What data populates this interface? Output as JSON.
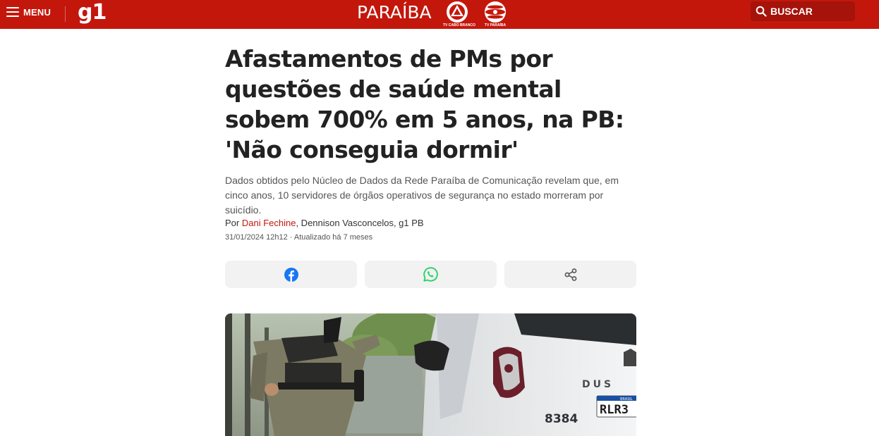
{
  "header": {
    "menu_label": "MENU",
    "logo": "g1",
    "region": "PARAÍBA",
    "affiliates": [
      {
        "label": "TV CABO BRANCO"
      },
      {
        "label": "TV PARAÍBA"
      }
    ],
    "search_label": "BUSCAR",
    "colors": {
      "brand": "#c4170c",
      "search_bg": "#a5130a"
    }
  },
  "article": {
    "title": "Afastamentos de PMs por questões de saúde mental sobem 700% em 5 anos, na PB: 'Não conseguia dormir'",
    "subtitle": "Dados obtidos pelo Núcleo de Dados da Rede Paraíba de Comunicação revelam que, em cinco anos, 10 servidores de órgãos operativos de segurança no estado morreram por suicídio.",
    "byline_prefix": "Por ",
    "author_link": "Dani Fechine",
    "byline_rest": ", Dennison Vasconcelos, g1 PB",
    "dateline": "31/01/2024 12h12 · Atualizado há 7 meses",
    "share": [
      {
        "icon": "facebook-icon",
        "color": "#1877f2"
      },
      {
        "icon": "whatsapp-icon",
        "color": "#25d366"
      },
      {
        "icon": "share-icon",
        "color": "#555555"
      }
    ],
    "photo": {
      "plate_text": "RLR3",
      "plate_country": "BRASIL",
      "car_number": "8384",
      "car_brand": "DUS"
    }
  }
}
